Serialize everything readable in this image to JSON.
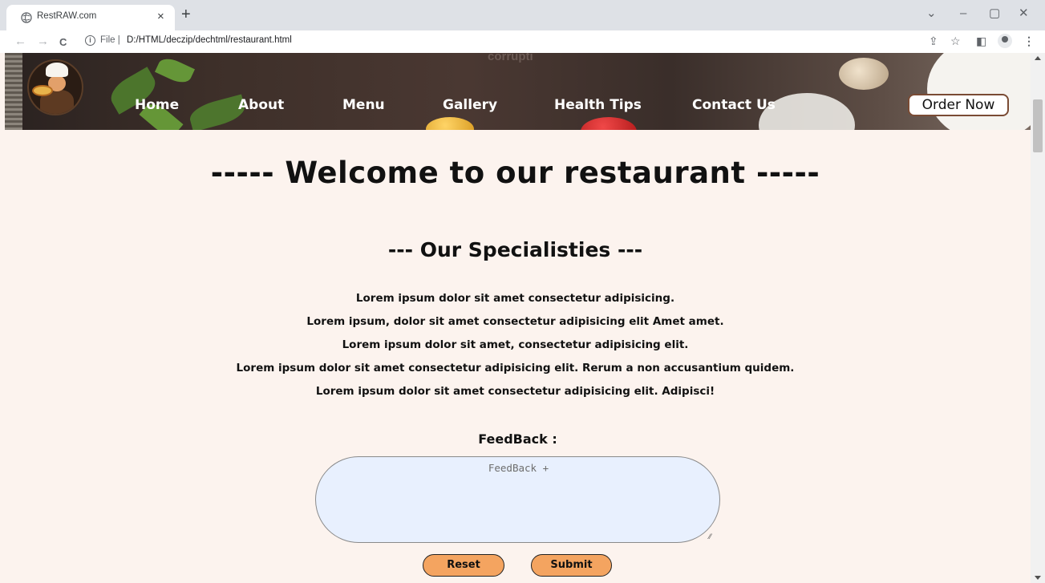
{
  "browser": {
    "tab_title": "RestRAW.com",
    "tab_close": "×",
    "new_tab": "+",
    "window_controls": {
      "dropdown": "⌄",
      "minimize": "–",
      "restore": "▢",
      "close": "✕"
    },
    "nav": {
      "back": "←",
      "forward": "→",
      "reload": "C"
    },
    "omnibox": {
      "scheme_label": "File",
      "separator": "|",
      "url": "D:/HTML/deczip/dechtml/restaurant.html"
    },
    "toolbar_icons": [
      "share-icon",
      "star-icon",
      "side-panel-icon",
      "profile-icon",
      "menu-icon"
    ]
  },
  "site": {
    "hero_faded_text": "corrupti",
    "nav": {
      "home": "Home",
      "about": "About",
      "menu": "Menu",
      "gallery": "Gallery",
      "health_tips": "Health Tips",
      "contact_us": "Contact Us"
    },
    "order_button": "Order Now",
    "welcome_heading": "----- Welcome to our restaurant -----",
    "specialties_heading": "--- Our Specialisties ---",
    "lorem": [
      "Lorem ipsum dolor sit amet consectetur adipisicing.",
      "Lorem ipsum, dolor sit amet consectetur adipisicing elit Amet amet.",
      "Lorem ipsum dolor sit amet, consectetur adipisicing elit.",
      "Lorem ipsum dolor sit amet consectetur adipisicing elit. Rerum a non accusantium quidem.",
      "Lorem ipsum dolor sit amet consectetur adipisicing elit. Adipisci!"
    ],
    "feedback": {
      "label": "FeedBack :",
      "placeholder": "FeedBack +",
      "reset_button": "Reset",
      "submit_button": "Submit"
    }
  },
  "colors": {
    "page_background": "#fcf3ee",
    "button_fill": "#f4a460",
    "feedback_fill": "#e8f0fe",
    "tabstrip": "#dee1e6"
  }
}
